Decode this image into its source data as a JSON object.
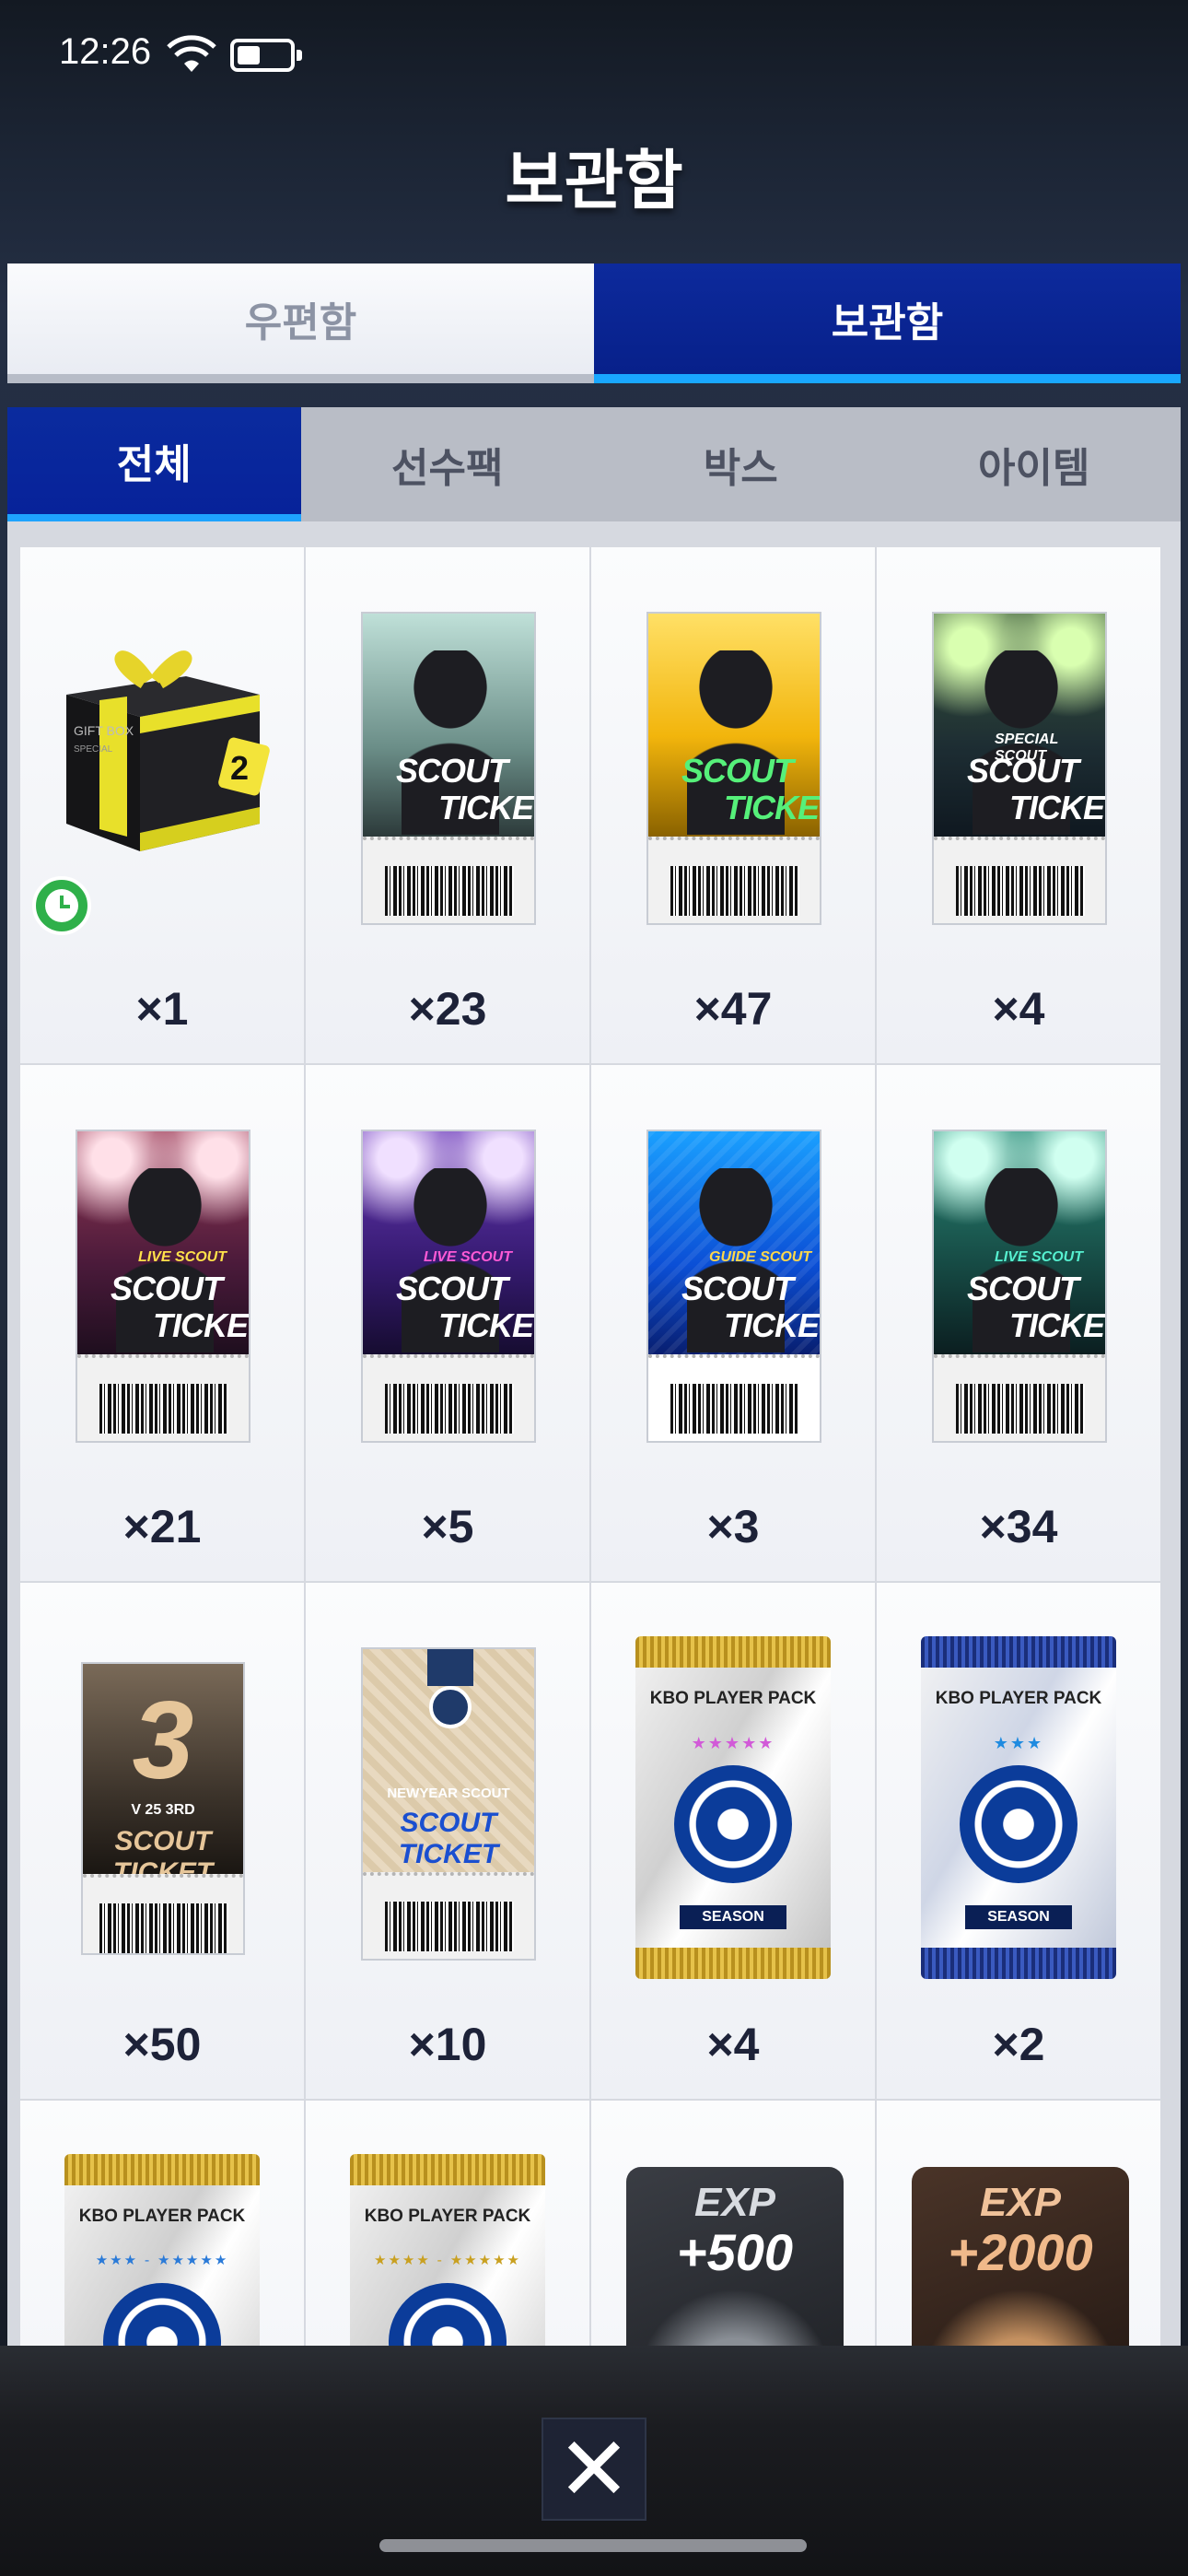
{
  "status_bar": {
    "time": "12:26"
  },
  "header": {
    "title": "보관함"
  },
  "top_tabs": [
    {
      "label": "우편함",
      "active": false
    },
    {
      "label": "보관함",
      "active": true
    }
  ],
  "sub_tabs": [
    {
      "label": "전체",
      "active": true
    },
    {
      "label": "선수팩",
      "active": false
    },
    {
      "label": "박스",
      "active": false
    },
    {
      "label": "아이템",
      "active": false
    }
  ],
  "items": [
    {
      "name": "GIFT BOX",
      "sub": "SPECIAL",
      "badge": "2",
      "count": "×1",
      "kind": "giftbox"
    },
    {
      "name": "SCOUT TICKET",
      "count": "×23",
      "kind": "ticket",
      "theme": "teal-gray"
    },
    {
      "name": "SCOUT TICKET",
      "count": "×47",
      "kind": "ticket",
      "theme": "gold"
    },
    {
      "name": "SCOUT TICKET",
      "sub": "SPECIAL SCOUT",
      "count": "×4",
      "kind": "ticket",
      "theme": "dark-teal"
    },
    {
      "name": "SCOUT TICKET",
      "sub": "LIVE SCOUT",
      "count": "×21",
      "kind": "ticket",
      "theme": "maroon"
    },
    {
      "name": "SCOUT TICKET",
      "sub": "LIVE SCOUT",
      "count": "×5",
      "kind": "ticket",
      "theme": "purple"
    },
    {
      "name": "SCOUT TICKET",
      "sub": "GUIDE SCOUT",
      "count": "×3",
      "kind": "ticket",
      "theme": "blue"
    },
    {
      "name": "SCOUT TICKET",
      "sub": "LIVE SCOUT",
      "count": "×34",
      "kind": "ticket",
      "theme": "green"
    },
    {
      "name": "SCOUT TICKET",
      "sub": "V 25 3RD",
      "big": "3",
      "count": "×50",
      "kind": "ticket",
      "theme": "bronze"
    },
    {
      "name": "SCOUT TICKET",
      "sub": "NEWYEAR SCOUT",
      "count": "×10",
      "kind": "ticket",
      "theme": "newyear"
    },
    {
      "name": "KBO PLAYER PACK",
      "stars": "★★★★★",
      "label": "SEASON",
      "count": "×4",
      "kind": "pack",
      "theme": "gold"
    },
    {
      "name": "KBO PLAYER PACK",
      "stars": "★★★",
      "label": "SEASON",
      "count": "×2",
      "kind": "pack",
      "theme": "blue"
    },
    {
      "name": "KBO PLAYER PACK",
      "stars": "★★★ - ★★★★★",
      "count": "",
      "kind": "pack",
      "theme": "gold"
    },
    {
      "name": "KBO PLAYER PACK",
      "stars": "★★★★ - ★★★★★",
      "count": "",
      "kind": "pack",
      "theme": "gold"
    },
    {
      "name": "EXP",
      "value": "+500",
      "count": "",
      "kind": "exp",
      "theme": "silver"
    },
    {
      "name": "EXP",
      "value": "+2000",
      "count": "",
      "kind": "exp",
      "theme": "bronze"
    }
  ],
  "close_button": {
    "label": "✕"
  },
  "colors": {
    "accent_blue": "#07208a",
    "tab_underline": "#19a7ff",
    "count_text": "#1d2238"
  }
}
